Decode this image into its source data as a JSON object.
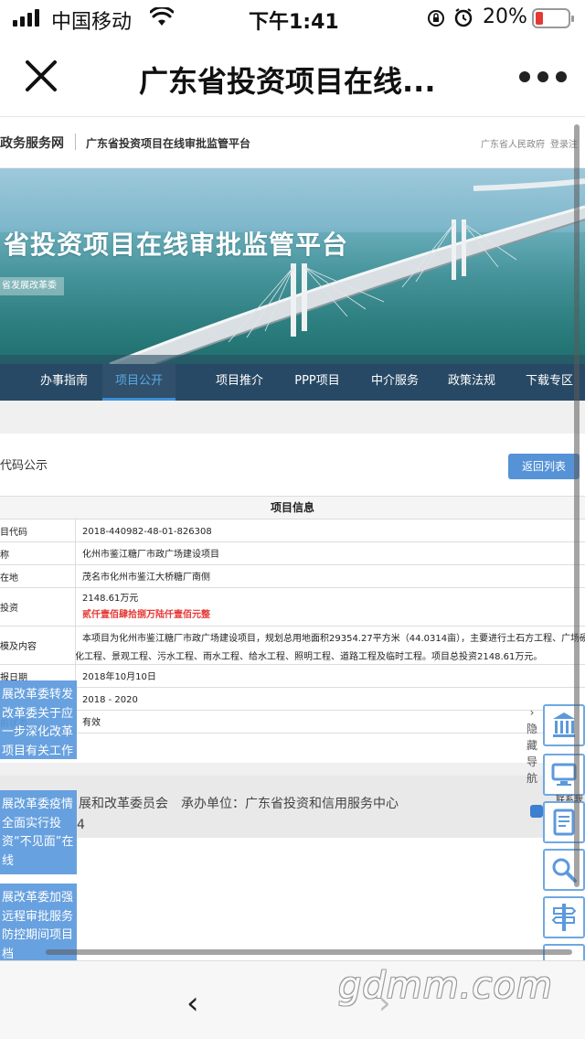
{
  "status_bar": {
    "carrier": "中国移动",
    "time": "下午1:41",
    "battery": "20%"
  },
  "nav_bar": {
    "title": "广东省投资项目在线..."
  },
  "site_header": {
    "brand": "政务服务网",
    "subtitle": "广东省投资项目在线审批监管平台",
    "gov_link": "广东省人民政府",
    "login_link": "登录注"
  },
  "banner": {
    "title": "省投资项目在线审批监管平台",
    "tag": "省发展改革委"
  },
  "menu": {
    "items": [
      {
        "label": "办事指南",
        "active": false
      },
      {
        "label": "项目公开",
        "active": true
      },
      {
        "label": "项目推介",
        "active": false
      },
      {
        "label": "PPP项目",
        "active": false
      },
      {
        "label": "中介服务",
        "active": false
      },
      {
        "label": "政策法规",
        "active": false
      },
      {
        "label": "下载专区",
        "active": false
      }
    ]
  },
  "panel": {
    "title": "代码公示",
    "back_button": "返回列表",
    "table_title": "项目信息",
    "rows": [
      {
        "key": "目代码",
        "value": "2018-440982-48-01-826308"
      },
      {
        "key": "称",
        "value": "化州市鉴江糖厂市政广场建设项目"
      },
      {
        "key": "在地",
        "value": "茂名市化州市鉴江大桥糖厂南侧"
      },
      {
        "key": "投资",
        "value": "2148.61万元",
        "value2": "贰仟壹佰肆拾捌万陆仟壹佰元整"
      },
      {
        "key": "模及内容",
        "value": "本项目为化州市鉴江糖厂市政广场建设项目，规划总用地面积29354.27平方米（44.0314亩），主要进行土石方工程、广场硬",
        "value_line2": "化工程、景观工程、污水工程、雨水工程、给水工程、照明工程、道路工程及临时工程。项目总投资2148.61万元。"
      },
      {
        "key": "报日期",
        "value": "2018年10月10日"
      },
      {
        "key": "",
        "value": "2018 - 2020"
      },
      {
        "key": "前状态",
        "value": "有效"
      }
    ]
  },
  "footer": {
    "line1_a": "展和改革委员会",
    "line1_b": "承办单位：广东省投资和信用服务中心",
    "line2": "4"
  },
  "news_tiles": [
    {
      "text": "展改革委转发改革委关于应一步深化改革项目有关工作"
    },
    {
      "text": "展改革委疫情全面实行投资“不见面”在线"
    },
    {
      "text": "展改革委加强远程审批服务防控期间项目档"
    }
  ],
  "side_nav": {
    "toggle": "隐藏导航",
    "label": "联系我"
  },
  "toolbar": {
    "back": "‹",
    "forward": "›",
    "watermark": "gdmm.com"
  }
}
